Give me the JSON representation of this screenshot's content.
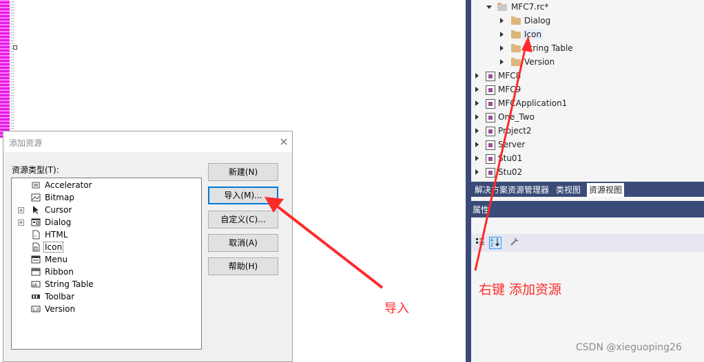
{
  "dialog": {
    "title": "添加资源",
    "close_icon": "×",
    "resource_type_label": "资源类型(T):",
    "resource_types": [
      {
        "label": "Accelerator",
        "expander": "",
        "icon": "accelerator-icon"
      },
      {
        "label": "Bitmap",
        "expander": "",
        "icon": "bitmap-icon"
      },
      {
        "label": "Cursor",
        "expander": "+",
        "icon": "cursor-icon"
      },
      {
        "label": "Dialog",
        "expander": "+",
        "icon": "dialog-icon"
      },
      {
        "label": "HTML",
        "expander": "",
        "icon": "html-icon"
      },
      {
        "label": "Icon",
        "expander": "",
        "icon": "icon-resource-icon",
        "selected": true
      },
      {
        "label": "Menu",
        "expander": "",
        "icon": "menu-icon"
      },
      {
        "label": "Ribbon",
        "expander": "",
        "icon": "ribbon-icon"
      },
      {
        "label": "String Table",
        "expander": "",
        "icon": "string-table-icon"
      },
      {
        "label": "Toolbar",
        "expander": "",
        "icon": "toolbar-icon"
      },
      {
        "label": "Version",
        "expander": "",
        "icon": "version-icon"
      }
    ],
    "buttons": {
      "new": "新建(N)",
      "import": "导入(M)...",
      "custom": "自定义(C)...",
      "cancel": "取消(A)",
      "help": "帮助(H)"
    }
  },
  "resource_view": {
    "root_file": "MFC7.rc*",
    "folders": [
      "Dialog",
      "Icon",
      "String Table",
      "Version"
    ],
    "projects": [
      "MFC8",
      "MFC9",
      "MFCApplication1",
      "One_Two",
      "Project2",
      "Server",
      "Stu01",
      "Stu02"
    ]
  },
  "tabs": [
    "解决方案资源管理器",
    "类视图",
    "资源视图"
  ],
  "active_tab": "资源视图",
  "properties": {
    "title": "属性",
    "toolbar_icons": [
      "categorized-icon",
      "alphabetical-icon",
      "property-pages-icon"
    ]
  },
  "annotations": {
    "import_note": "导入",
    "right_click_note": "右键 添加资源",
    "color": "#ff2a2a"
  },
  "watermark": "CSDN @xieguoping26"
}
